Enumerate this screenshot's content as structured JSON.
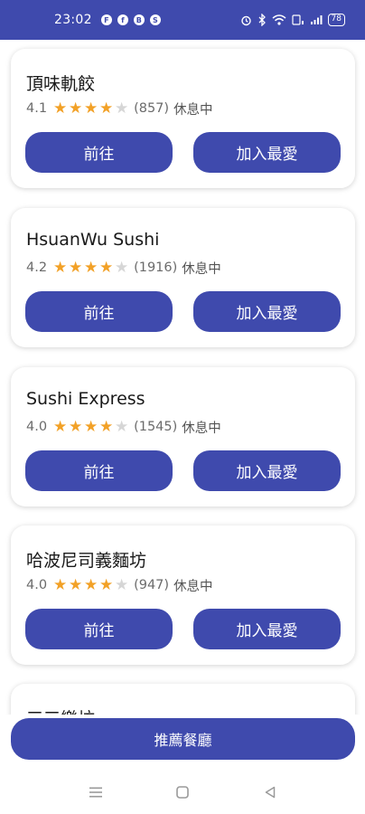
{
  "status_bar": {
    "time": "23:02",
    "app_icons": [
      "F",
      "f",
      "B",
      "S"
    ],
    "battery": "78"
  },
  "restaurants": [
    {
      "name": "頂味軌餃",
      "rating": "4.1",
      "stars_filled": 4,
      "reviews": "(857)",
      "status": "休息中",
      "go_label": "前往",
      "fav_label": "加入最愛"
    },
    {
      "name": "HsuanWu Sushi",
      "rating": "4.2",
      "stars_filled": 4,
      "reviews": "(1916)",
      "status": "休息中",
      "go_label": "前往",
      "fav_label": "加入最愛"
    },
    {
      "name": "Sushi Express",
      "rating": "4.0",
      "stars_filled": 4,
      "reviews": "(1545)",
      "status": "休息中",
      "go_label": "前往",
      "fav_label": "加入最愛"
    },
    {
      "name": "哈波尼司義麵坊",
      "rating": "4.0",
      "stars_filled": 4,
      "reviews": "(947)",
      "status": "休息中",
      "go_label": "前往",
      "fav_label": "加入最愛"
    }
  ],
  "partial_card": {
    "name": "三三樂坊"
  },
  "bottom_action": {
    "label": "推薦餐廳"
  },
  "colors": {
    "primary": "#3f4aad",
    "star_on": "#f2a127",
    "star_off": "#d6d6d6"
  },
  "nav": {
    "menu_icon": "menu-icon",
    "home_icon": "home-square-icon",
    "back_icon": "back-triangle-icon"
  }
}
